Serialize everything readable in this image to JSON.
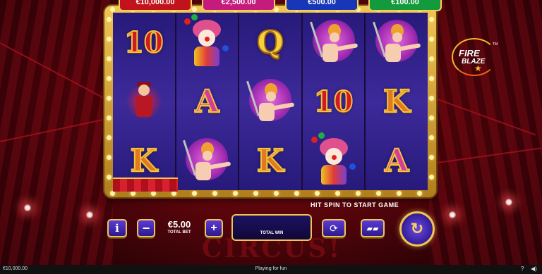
{
  "jackpots": [
    {
      "value": "€10,000.00",
      "color": "#c2131c"
    },
    {
      "value": "€2,500.00",
      "color": "#c41b7c"
    },
    {
      "value": "€500.00",
      "color": "#1837b8"
    },
    {
      "value": "€100.00",
      "color": "#139a3c"
    }
  ],
  "reels": [
    [
      {
        "type": "letter",
        "label": "10",
        "color": "red"
      },
      {
        "type": "boy",
        "icon": "ringmaster-boy-icon"
      },
      {
        "type": "letter",
        "label": "K",
        "color": "orange"
      }
    ],
    [
      {
        "type": "clown",
        "icon": "clown-juggler-icon"
      },
      {
        "type": "letter",
        "label": "A",
        "color": "pink"
      },
      {
        "type": "acrobat",
        "icon": "trapeze-acrobat-icon"
      }
    ],
    [
      {
        "type": "letter",
        "label": "Q",
        "color": "gold"
      },
      {
        "type": "acrobat",
        "icon": "trapeze-acrobat-icon"
      },
      {
        "type": "letter",
        "label": "K",
        "color": "orange"
      }
    ],
    [
      {
        "type": "acrobat",
        "icon": "trapeze-acrobat-icon"
      },
      {
        "type": "letter",
        "label": "10",
        "color": "red"
      },
      {
        "type": "clown",
        "icon": "clown-juggler-icon"
      }
    ],
    [
      {
        "type": "acrobat",
        "icon": "trapeze-acrobat-icon"
      },
      {
        "type": "letter",
        "label": "K",
        "color": "orange"
      },
      {
        "type": "letter",
        "label": "A",
        "color": "pink"
      }
    ]
  ],
  "logo": {
    "line1": "FIRE",
    "line2": "BLAZE",
    "tm": "TM"
  },
  "background_title": "CIRCUS!",
  "hint": "HIT SPIN TO START GAME",
  "controls": {
    "bet_value": "€5.00",
    "bet_label": "TOTAL BET",
    "win_label": "TOTAL WIN"
  },
  "status": {
    "balance": "€10,000.00",
    "mode": "Playing for fun"
  },
  "colors": {
    "background": "#5a050b",
    "frame_gold": "#f0c555",
    "button_purple": "#3d2ab0"
  }
}
